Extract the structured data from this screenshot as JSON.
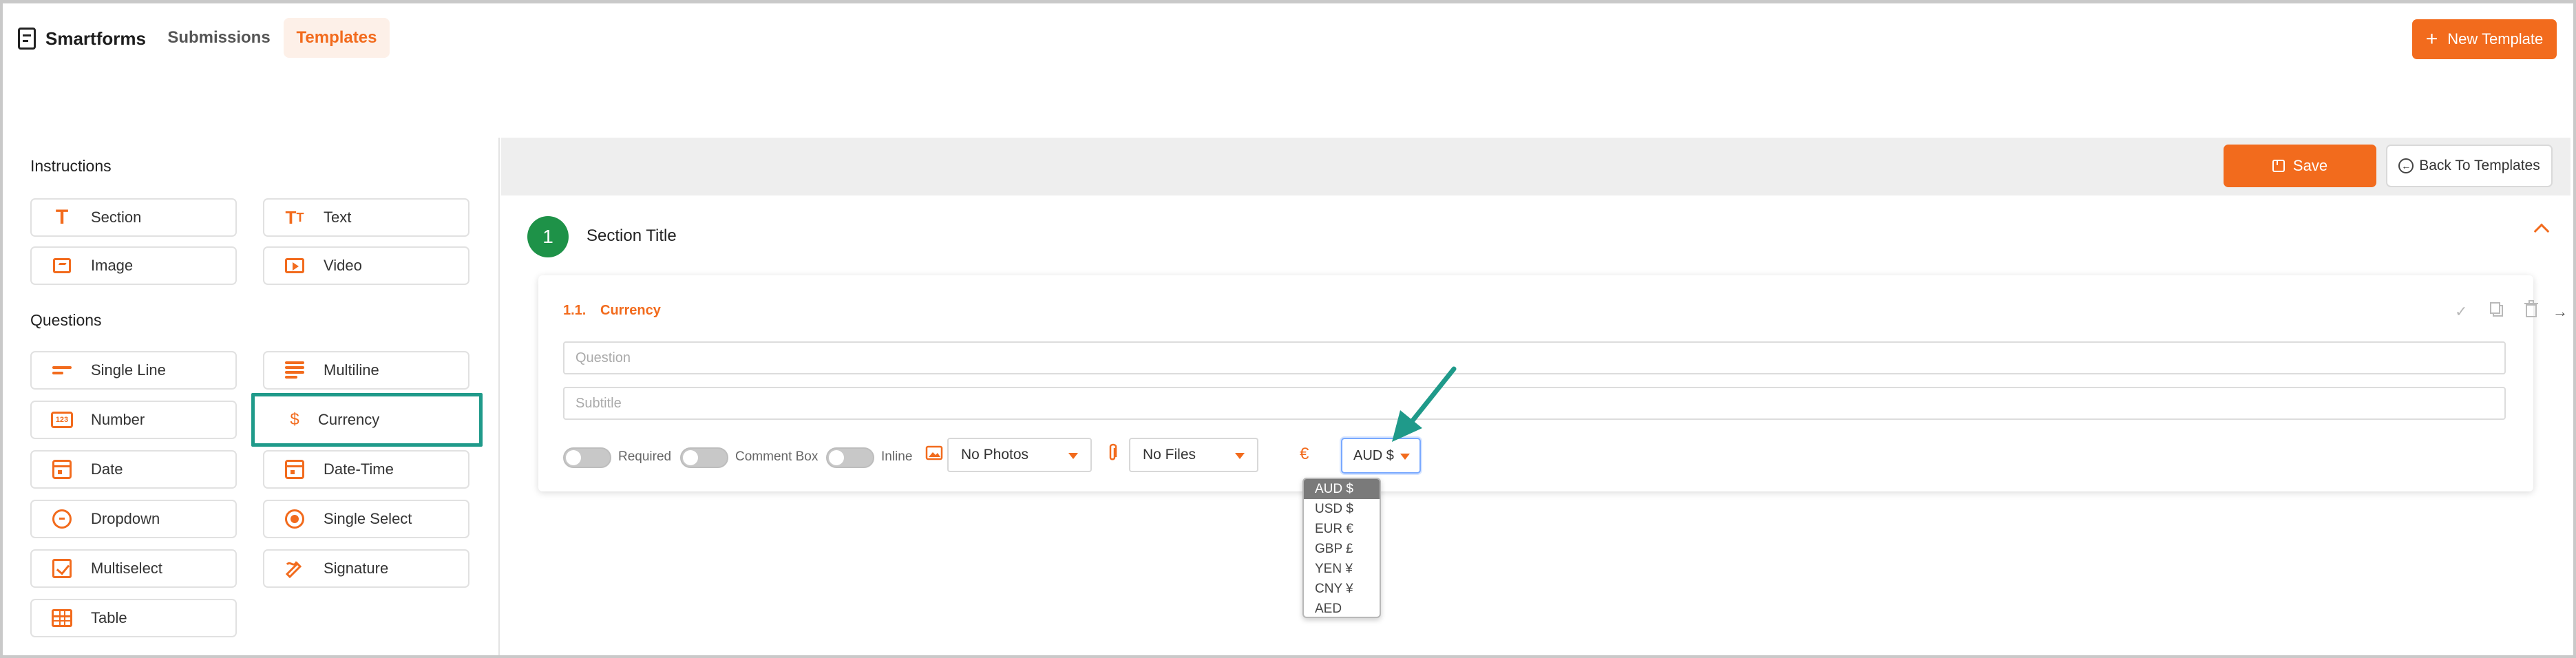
{
  "nav": {
    "brand": "Smartforms",
    "tabs": [
      {
        "label": "Submissions"
      },
      {
        "label": "Templates"
      }
    ],
    "new_template_label": "New Template"
  },
  "sidebar": {
    "instructions_heading": "Instructions",
    "questions_heading": "Questions",
    "instructions": [
      {
        "label": "Section",
        "icon": "section-icon"
      },
      {
        "label": "Text",
        "icon": "text-icon"
      },
      {
        "label": "Image",
        "icon": "image-icon"
      },
      {
        "label": "Video",
        "icon": "video-icon"
      }
    ],
    "questions": [
      {
        "label": "Single Line",
        "icon": "single-line-icon"
      },
      {
        "label": "Multiline",
        "icon": "multiline-icon"
      },
      {
        "label": "Number",
        "icon": "number-icon"
      },
      {
        "label": "Currency",
        "icon": "currency-icon"
      },
      {
        "label": "Date",
        "icon": "calendar-icon"
      },
      {
        "label": "Date-Time",
        "icon": "calendar-icon"
      },
      {
        "label": "Dropdown",
        "icon": "dropdown-icon"
      },
      {
        "label": "Single Select",
        "icon": "radio-icon"
      },
      {
        "label": "Multiselect",
        "icon": "checkbox-icon"
      },
      {
        "label": "Signature",
        "icon": "signature-icon"
      },
      {
        "label": "Table",
        "icon": "table-icon"
      }
    ],
    "number_icon_text": "123",
    "currency_icon_text": "$"
  },
  "builder": {
    "save_label": "Save",
    "back_label": "Back To Templates",
    "section": {
      "number": "1",
      "title": "Section Title"
    },
    "question": {
      "number": "1.1.",
      "type": "Currency",
      "question_placeholder": "Question",
      "subtitle_placeholder": "Subtitle",
      "required_label": "Required",
      "comment_label": "Comment Box",
      "inline_label": "Inline",
      "photos_value": "No Photos",
      "files_value": "No Files",
      "currency_symbol": "€",
      "currency_value": "AUD $",
      "currency_options": [
        "AUD $",
        "USD $",
        "EUR €",
        "GBP £",
        "YEN ¥",
        "CNY ¥",
        "AED"
      ]
    }
  },
  "colors": {
    "accent": "#f26b1d",
    "highlight": "#1f9a8a",
    "section_badge": "#1e9248"
  }
}
